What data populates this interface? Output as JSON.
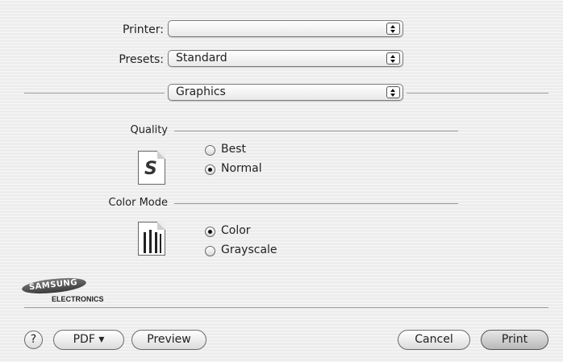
{
  "printer": {
    "label": "Printer:",
    "value": ""
  },
  "presets": {
    "label": "Presets:",
    "value": "Standard"
  },
  "panel": {
    "value": "Graphics"
  },
  "quality": {
    "title": "Quality",
    "icon_letter": "S",
    "options": [
      {
        "label": "Best",
        "selected": false
      },
      {
        "label": "Normal",
        "selected": true
      }
    ]
  },
  "color_mode": {
    "title": "Color Mode",
    "options": [
      {
        "label": "Color",
        "selected": true
      },
      {
        "label": "Grayscale",
        "selected": false
      }
    ]
  },
  "logo": {
    "line1": "SAMSUNG",
    "line2": "ELECTRONICS"
  },
  "buttons": {
    "help": "?",
    "pdf": "PDF ▾",
    "preview": "Preview",
    "cancel": "Cancel",
    "print": "Print"
  },
  "icons": [
    "stepper-arrows-icon",
    "quality-document-icon",
    "color-cartridge-icon",
    "help-icon"
  ]
}
